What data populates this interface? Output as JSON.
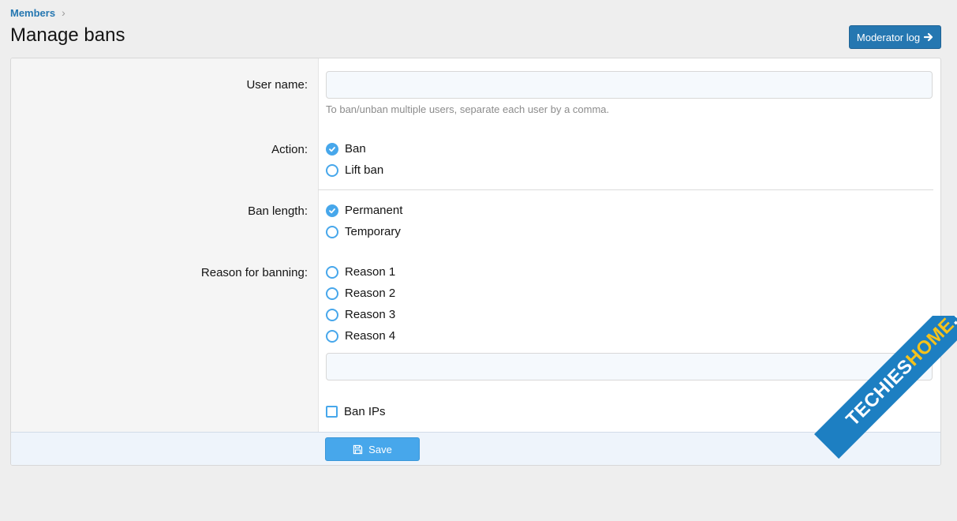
{
  "breadcrumb": {
    "label": "Members",
    "separator": "›"
  },
  "page": {
    "title": "Manage bans"
  },
  "header": {
    "moderator_log_label": "Moderator log",
    "moderator_log_icon": "arrow-right-icon"
  },
  "form": {
    "username": {
      "label": "User name:",
      "value": "",
      "hint": "To ban/unban multiple users, separate each user by a comma."
    },
    "action": {
      "label": "Action:",
      "options": [
        "Ban",
        "Lift ban"
      ],
      "selected": "Ban"
    },
    "ban_length": {
      "label": "Ban length:",
      "options": [
        "Permanent",
        "Temporary"
      ],
      "selected": "Permanent"
    },
    "reason": {
      "label": "Reason for banning:",
      "options": [
        "Reason 1",
        "Reason 2",
        "Reason 3",
        "Reason 4"
      ],
      "selected": null,
      "custom_value": ""
    },
    "ban_ips": {
      "label": "Ban IPs",
      "checked": false
    }
  },
  "footer": {
    "save_label": "Save",
    "save_icon": "save-icon"
  },
  "watermark": {
    "text_main": "TECHIES",
    "text_accent": "HOME",
    "text_suffix": ".COM"
  },
  "colors": {
    "accent": "#47a7eb",
    "primary_button": "#2577b1",
    "link": "#2577b1"
  }
}
